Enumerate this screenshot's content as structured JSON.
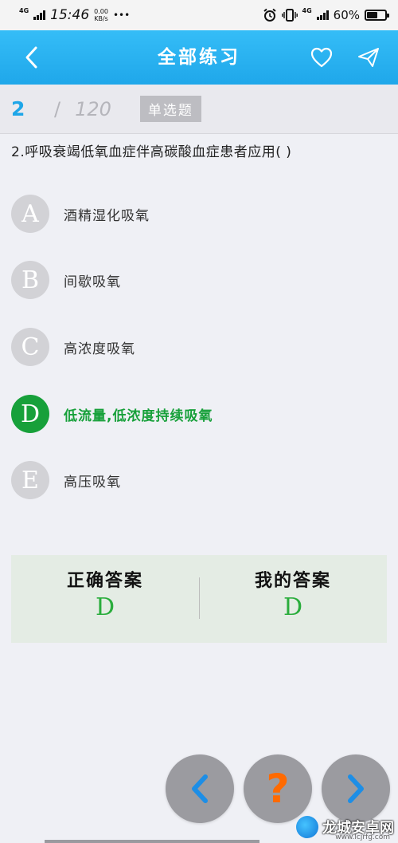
{
  "status_bar": {
    "network_left": "4G",
    "time": "15:46",
    "speed_value": "0.00",
    "speed_unit": "KB/s",
    "more": "•••",
    "network_right": "4G",
    "battery_text": "60%",
    "battery_level": 0.6
  },
  "header": {
    "title": "全部练习"
  },
  "progress": {
    "current": "2",
    "separator": "/",
    "total": "120",
    "question_type": "单选题"
  },
  "question": {
    "text": "2.呼吸衰竭低氧血症伴高碳酸血症患者应用( )"
  },
  "options": [
    {
      "letter": "A",
      "text": "酒精湿化吸氧",
      "selected": false
    },
    {
      "letter": "B",
      "text": "间歇吸氧",
      "selected": false
    },
    {
      "letter": "C",
      "text": "高浓度吸氧",
      "selected": false
    },
    {
      "letter": "D",
      "text": "低流量,低浓度持续吸氧",
      "selected": true
    },
    {
      "letter": "E",
      "text": "高压吸氧",
      "selected": false
    }
  ],
  "answer": {
    "correct_label": "正确答案",
    "correct_value": "D",
    "mine_label": "我的答案",
    "mine_value": "D"
  },
  "navigation": {
    "help_symbol": "?"
  },
  "watermark": {
    "text": "龙城安卓网",
    "url": "www.lcjrfg.com"
  },
  "colors": {
    "primary_blue": "#1fa7ea",
    "selected_green": "#17a03a",
    "help_orange": "#ff6a00"
  }
}
